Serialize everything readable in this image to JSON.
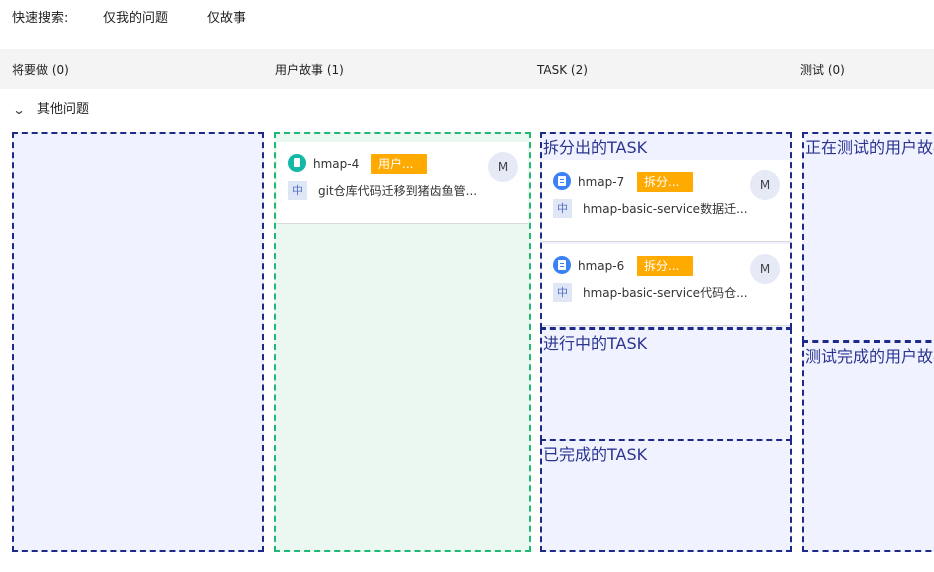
{
  "quick_filters": {
    "label": "快速搜索:",
    "mine": "仅我的问题",
    "stories": "仅故事"
  },
  "columns": [
    {
      "label": "将要做 (0)"
    },
    {
      "label": "用户故事 (1)"
    },
    {
      "label": "TASK (2)"
    },
    {
      "label": "测试 (0)"
    }
  ],
  "swimlane": {
    "label": "其他问题"
  },
  "zones": {
    "split": "拆分出的TASK",
    "in_progress": "进行中的TASK",
    "done": "已完成的TASK",
    "testing": "正在测试的用户故事",
    "tested": "测试完成的用户故事"
  },
  "cards": {
    "story": {
      "key": "hmap-4",
      "tag": "用户...",
      "priority": "中",
      "summary": "git仓库代码迁移到猪齿鱼管...",
      "assignee": "M",
      "icon": "story-icon"
    },
    "task7": {
      "key": "hmap-7",
      "tag": "拆分...",
      "priority": "中",
      "summary": "hmap-basic-service数据迁...",
      "assignee": "M",
      "icon": "task-icon"
    },
    "task6": {
      "key": "hmap-6",
      "tag": "拆分...",
      "priority": "中",
      "summary": "hmap-basic-service代码仓...",
      "assignee": "M",
      "icon": "task-icon"
    }
  },
  "colors": {
    "zone_border": "#1d2a8a",
    "zone_bg": "#f0f2ff",
    "story_zone_border": "#1fb875",
    "story_zone_bg": "#ebf7f1",
    "tag": "#ffaa00",
    "story_icon": "#14b8a6",
    "task_icon": "#3b82f6"
  }
}
